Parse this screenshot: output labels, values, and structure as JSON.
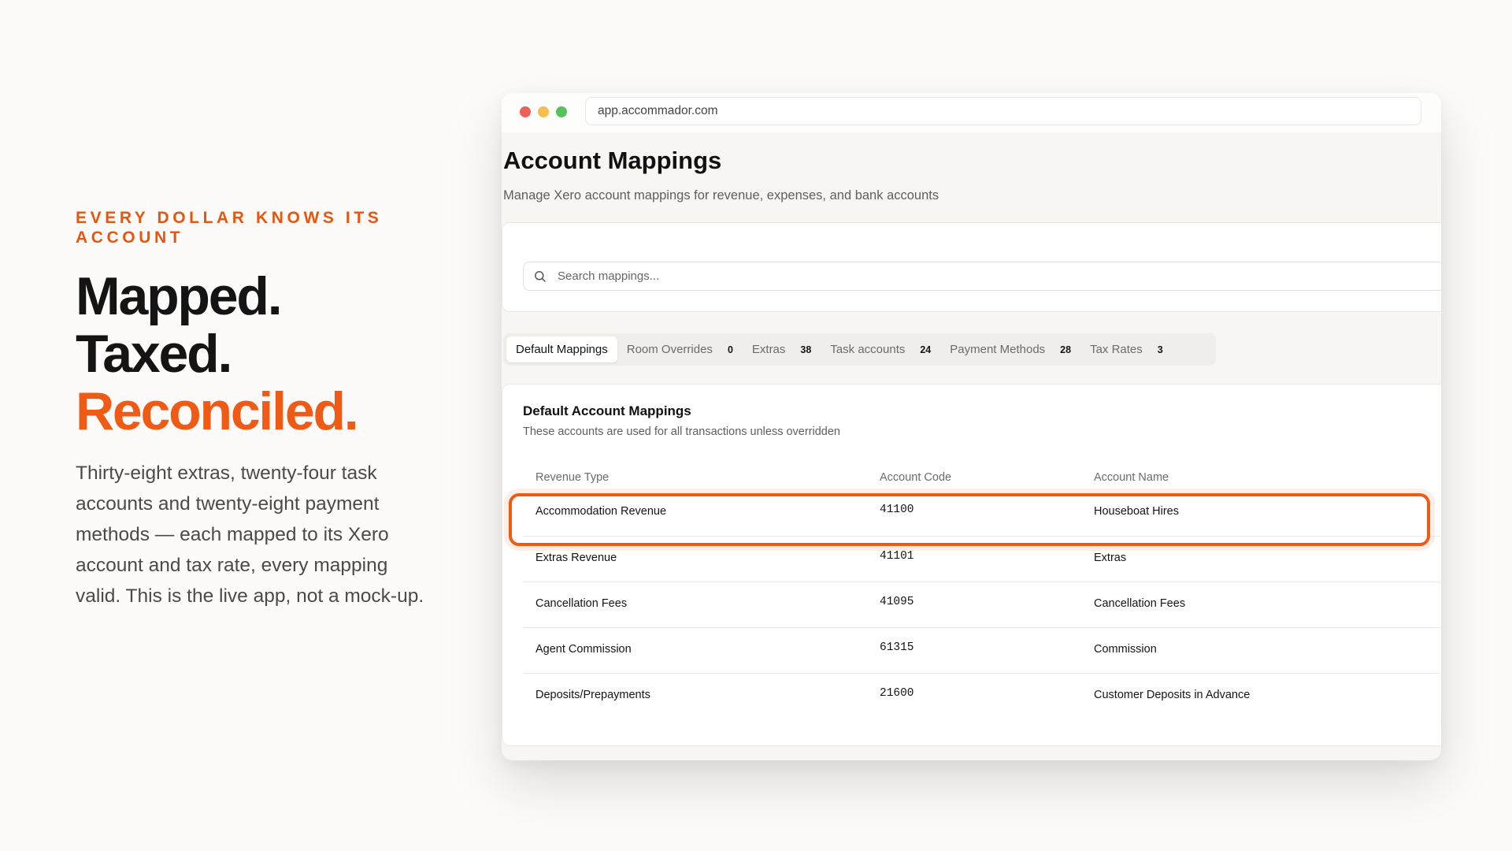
{
  "marketing": {
    "eyebrow": "EVERY DOLLAR KNOWS ITS ACCOUNT",
    "headline_line1": "Mapped.",
    "headline_line2": "Taxed.",
    "headline_line3": "Reconciled.",
    "body": "Thirty-eight extras, twenty-four task accounts and twenty-eight payment methods — each mapped to its Xero account and tax rate, every mapping valid. This is the live app, not a mock-up.",
    "accent_color": "#ef5a14"
  },
  "browser": {
    "url": "app.accommador.com"
  },
  "page": {
    "title": "Account Mappings",
    "subtitle": "Manage Xero account mappings for revenue, expenses, and bank accounts"
  },
  "search": {
    "placeholder": "Search mappings...",
    "icon": "search-icon"
  },
  "tabs": [
    {
      "label": "Default Mappings",
      "count": "",
      "active": true
    },
    {
      "label": "Room Overrides",
      "count": "0"
    },
    {
      "label": "Extras",
      "count": "38"
    },
    {
      "label": "Task accounts",
      "count": "24"
    },
    {
      "label": "Payment Methods",
      "count": "28"
    },
    {
      "label": "Tax Rates",
      "count": "3"
    }
  ],
  "card": {
    "title": "Default Account Mappings",
    "description": "These accounts are used for all transactions unless overridden"
  },
  "table": {
    "headers": [
      "Revenue Type",
      "Account Code",
      "Account Name"
    ],
    "rows": [
      {
        "type": "Accommodation Revenue",
        "code": "41100",
        "name": "Houseboat Hires",
        "highlighted": true
      },
      {
        "type": "Extras Revenue",
        "code": "41101",
        "name": "Extras"
      },
      {
        "type": "Cancellation Fees",
        "code": "41095",
        "name": "Cancellation Fees"
      },
      {
        "type": "Agent Commission",
        "code": "61315",
        "name": "Commission"
      },
      {
        "type": "Deposits/Prepayments",
        "code": "21600",
        "name": "Customer Deposits in Advance"
      }
    ]
  }
}
